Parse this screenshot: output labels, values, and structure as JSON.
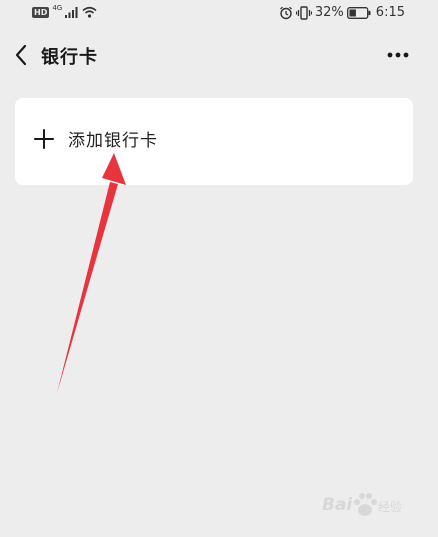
{
  "status_bar": {
    "hd_badge": "HD",
    "network_type": "4G",
    "battery_percent": "32%",
    "time": "6:15",
    "icons": [
      "hd-icon",
      "signal-icon",
      "wifi-icon",
      "alarm-icon",
      "vibrate-icon",
      "battery-icon"
    ]
  },
  "nav": {
    "title": "银行卡",
    "back_icon": "chevron-left-icon",
    "more_icon": "more-dots-icon"
  },
  "card": {
    "add_label": "添加银行卡",
    "add_icon": "plus-icon"
  },
  "annotation": {
    "arrow_color": "#e8343c"
  },
  "watermark": {
    "left_text": "Bai",
    "right_text": "经验"
  }
}
